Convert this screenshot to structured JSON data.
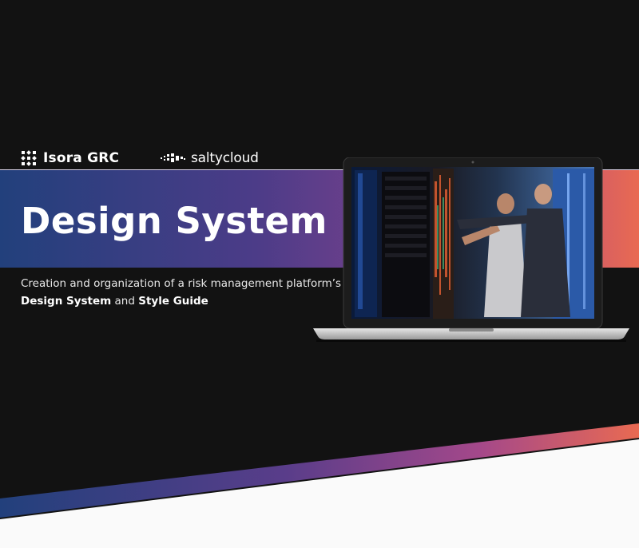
{
  "brand": {
    "isora_logo": "Isora GRC",
    "saltycloud_logo": "saltycloud"
  },
  "hero": {
    "title": "Design System",
    "subtitle_text": "Creation and organization of a risk management platform’s",
    "subtitle_bold_1": "Design System",
    "subtitle_joiner": "and",
    "subtitle_bold_2": "Style Guide"
  },
  "colors": {
    "background": "#121212",
    "gradient_start": "#22407c",
    "gradient_mid": "#84428e",
    "gradient_end": "#e96a52",
    "bottom_panel": "#fafafa"
  },
  "icons": {
    "isora": "isora-grid-icon",
    "saltycloud": "saltycloud-pixel-icon",
    "laptop": "laptop-mockup"
  }
}
